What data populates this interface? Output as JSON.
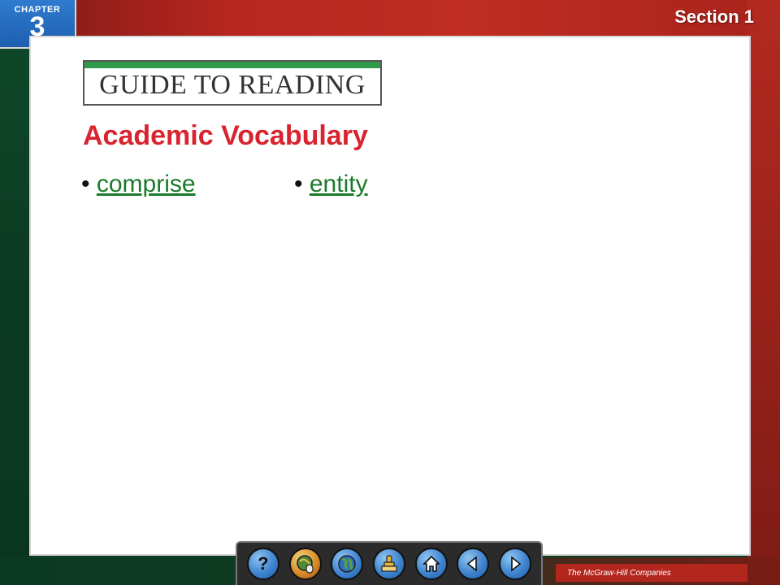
{
  "header": {
    "chapter_label": "CHAPTER",
    "chapter_number": "3",
    "section_label": "Section 1"
  },
  "banner": {
    "text": "GUIDE TO READING"
  },
  "content": {
    "heading": "Academic Vocabulary",
    "terms": [
      {
        "bullet": "•",
        "label": "comprise"
      },
      {
        "bullet": "•",
        "label": "entity"
      }
    ]
  },
  "nav": {
    "buttons": [
      {
        "icon": "help-icon",
        "label": "?"
      },
      {
        "icon": "globe-mouse-icon"
      },
      {
        "icon": "globe-icon"
      },
      {
        "icon": "stamp-icon"
      },
      {
        "icon": "home-icon"
      },
      {
        "icon": "arrow-left-icon"
      },
      {
        "icon": "arrow-right-icon"
      }
    ]
  },
  "footer": {
    "publisher": "The McGraw·Hill Companies"
  },
  "colors": {
    "heading": "#d9232e",
    "link": "#1a7a2a",
    "banner_strip": "#2e9a4a",
    "chapter_tab": "#1d5fae"
  }
}
